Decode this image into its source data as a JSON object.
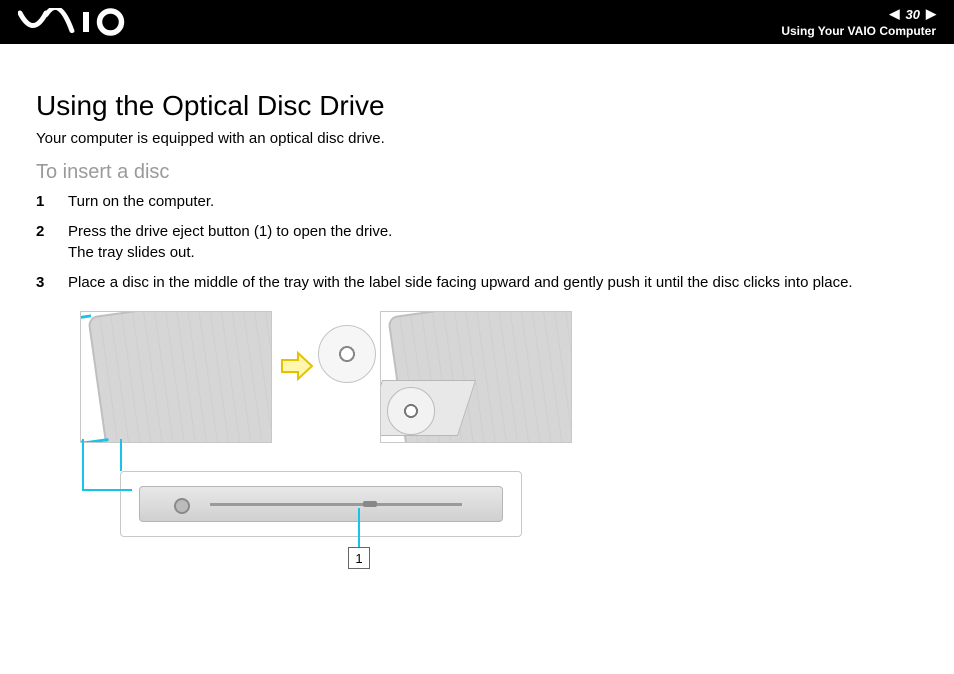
{
  "header": {
    "logo_alt": "VAIO",
    "page_number": "30",
    "breadcrumb": "Using Your VAIO Computer"
  },
  "body": {
    "title": "Using the Optical Disc Drive",
    "intro": "Your computer is equipped with an optical disc drive.",
    "subhead": "To insert a disc",
    "steps": [
      "Turn on the computer.",
      "Press the drive eject button (1) to open the drive.\nThe tray slides out.",
      "Place a disc in the middle of the tray with the label side facing upward and gently push it until the disc clicks into place."
    ],
    "callout_label": "1"
  },
  "colors": {
    "accent": "#17c3e6",
    "arrow_fill": "#fff6b0",
    "arrow_stroke": "#e5c100"
  }
}
